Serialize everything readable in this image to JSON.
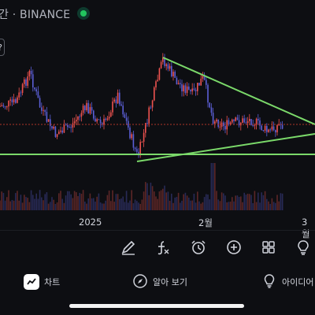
{
  "header": {
    "symbol_title": "간 · BINANCE",
    "tool_chip_label": "?"
  },
  "chart": {
    "x_axis_labels": [
      "2025",
      "2월",
      "3월"
    ],
    "colors": {
      "background": "#0d0e12",
      "up_candle": "#ef5350",
      "down_candle": "#5b5fd6",
      "trendline": "#7bd96a",
      "price_line": "#c0392b"
    }
  },
  "drawing_toolbar": {
    "tools": [
      "pencil-icon",
      "function-icon",
      "alarm-icon",
      "plus-circle-icon",
      "grid-icon",
      "bulb-icon"
    ]
  },
  "bottom_tabs": [
    {
      "label": "차트",
      "icon": "chart-icon"
    },
    {
      "label": "알아 보기",
      "icon": "compass-icon"
    },
    {
      "label": "아이디어",
      "icon": "bulb-icon"
    }
  ]
}
